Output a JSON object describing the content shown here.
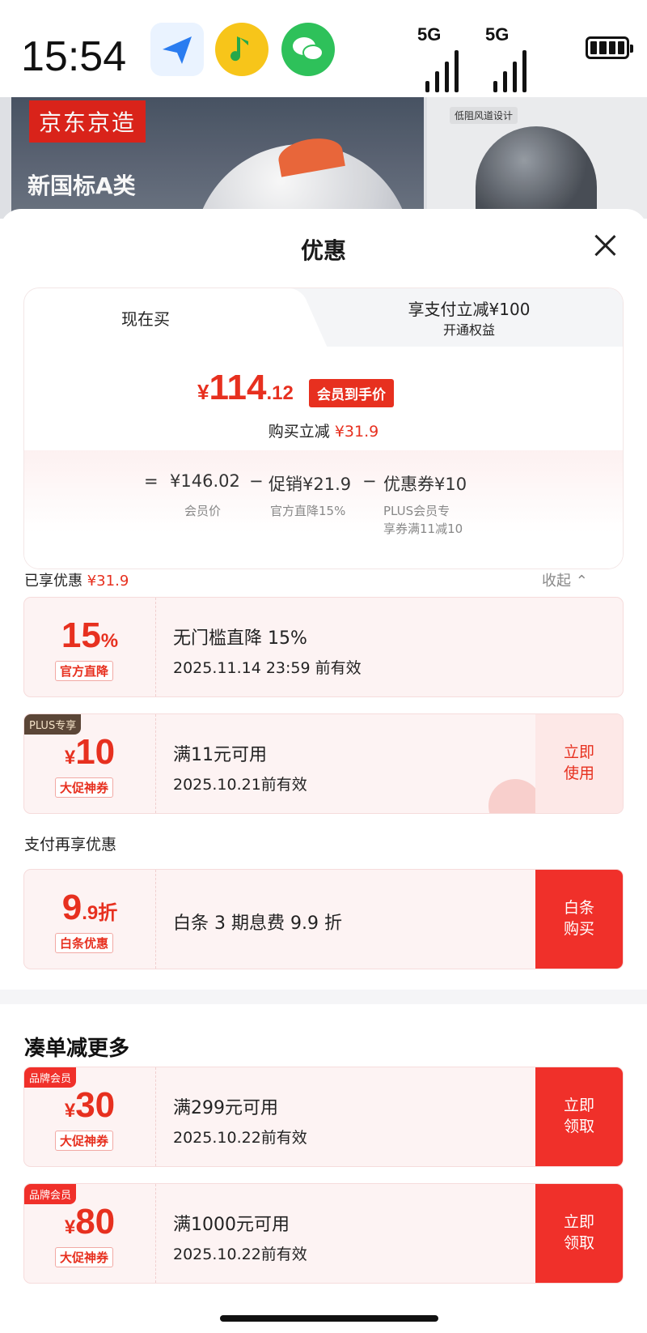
{
  "status_bar": {
    "time": "15:54",
    "signal1": "5G",
    "signal2": "5G"
  },
  "banner": {
    "brand": "京东京造",
    "title": "新国标A类",
    "right_caption": "低阻风道设计"
  },
  "sheet": {
    "title": "优惠",
    "tabs": {
      "now": "现在买",
      "pay_offer": "享支付立减¥100",
      "pay_offer_sub": "开通权益"
    },
    "price": {
      "symbol": "¥",
      "integer": "114",
      "decimal": ".12",
      "tag": "会员到手价"
    },
    "buy_off": {
      "label": "购买立减 ",
      "amount": "¥31.9"
    },
    "formula": {
      "eq": "=",
      "member_price": "¥146.02",
      "member_price_label": "会员价",
      "minus1": "−",
      "promo": "促销¥21.9",
      "promo_label": "官方直降15%",
      "minus2": "−",
      "coupon": "优惠券¥10",
      "coupon_label1": "PLUS会员专",
      "coupon_label2": "享券满11减10"
    },
    "enjoyed": {
      "label": "已享优惠 ",
      "amount": "¥31.9",
      "collapse": "收起 ⌃"
    },
    "coupons": [
      {
        "value_big": "15",
        "value_small": "%",
        "prefix": "",
        "tag": "官方直降",
        "title": "无门槛直降 15%",
        "date": "2025.11.14 23:59 前有效"
      },
      {
        "corner": "PLUS专享",
        "prefix": "¥",
        "value_big": "10",
        "value_small": "",
        "tag": "大促神券",
        "title": "满11元可用",
        "date": "2025.10.21前有效",
        "action1": "立即",
        "action2": "使用"
      }
    ],
    "pay_section": "支付再享优惠",
    "pay_coupon": {
      "value_big": "9",
      "value_small": ".9折",
      "tag": "白条优惠",
      "title": "白条 3 期息费 9.9 折",
      "action1": "白条",
      "action2": "购买"
    },
    "more_section": "凑单减更多",
    "more_coupons": [
      {
        "corner": "品牌会员",
        "prefix": "¥",
        "value_big": "30",
        "tag": "大促神券",
        "title": "满299元可用",
        "date": "2025.10.22前有效",
        "action1": "立即",
        "action2": "领取"
      },
      {
        "corner": "品牌会员",
        "prefix": "¥",
        "value_big": "80",
        "tag": "大促神券",
        "title": "满1000元可用",
        "date": "2025.10.22前有效",
        "action1": "立即",
        "action2": "领取"
      }
    ]
  },
  "colors": {
    "accent": "#e7301f",
    "button": "#f0302a",
    "coupon_bg": "#fdf3f3"
  }
}
